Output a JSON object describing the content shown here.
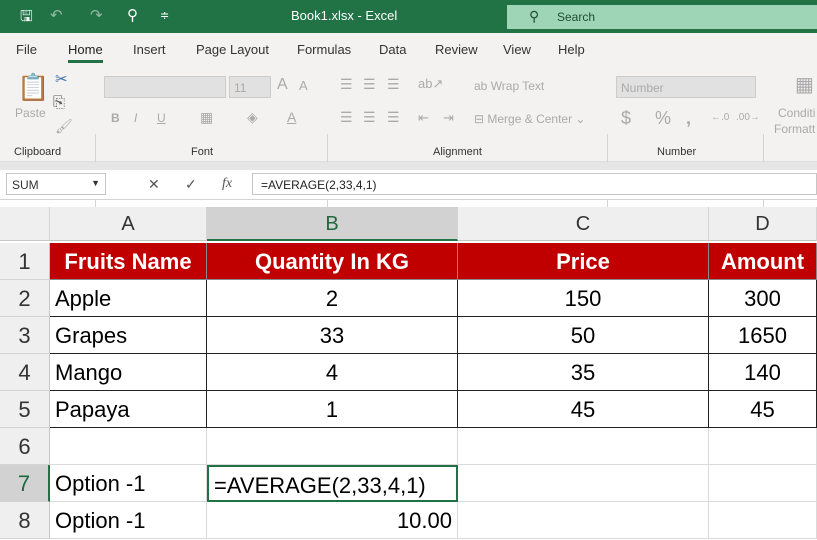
{
  "titlebar": {
    "title": "Book1.xlsx  -  Excel",
    "search": "Search"
  },
  "tabs": [
    "File",
    "Home",
    "Insert",
    "Page Layout",
    "Formulas",
    "Data",
    "Review",
    "View",
    "Help"
  ],
  "ribbon": {
    "paste": "Paste",
    "font_size": "11",
    "wrap_text": "Wrap Text",
    "merge_center": "Merge & Center",
    "number_format": "Number",
    "conditional": "Conditi",
    "formatting": "Formatt",
    "groups": [
      "Clipboard",
      "Font",
      "Alignment",
      "Number"
    ]
  },
  "formula_bar": {
    "name_box": "SUM",
    "formula": "=AVERAGE(2,33,4,1)"
  },
  "columns": [
    "A",
    "B",
    "C",
    "D"
  ],
  "rows": [
    "1",
    "2",
    "3",
    "4",
    "5",
    "6",
    "7",
    "8"
  ],
  "table": {
    "headers": [
      "Fruits Name",
      "Quantity In KG",
      "Price",
      "Amount"
    ],
    "data": [
      [
        "Apple",
        "2",
        "150",
        "300"
      ],
      [
        "Grapes",
        "33",
        "50",
        "1650"
      ],
      [
        "Mango",
        "4",
        "35",
        "140"
      ],
      [
        "Papaya",
        "1",
        "45",
        "45"
      ]
    ]
  },
  "row7": {
    "a": "Option -1",
    "b": "=AVERAGE(2,33,4,1)"
  },
  "row8": {
    "a": "Option -1",
    "b": "10.00"
  },
  "colors": {
    "excel_green": "#217346",
    "header_red": "#c00000"
  }
}
